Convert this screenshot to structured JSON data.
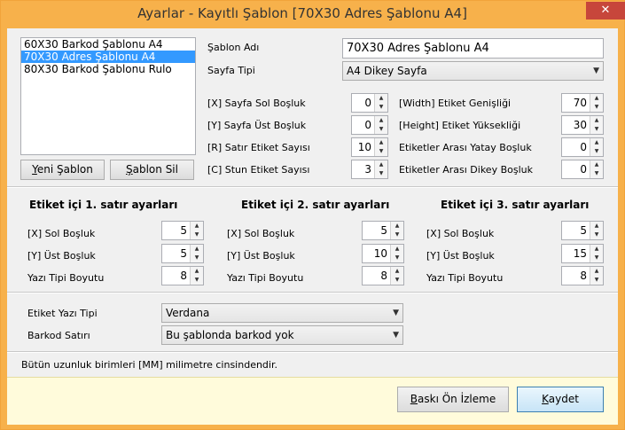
{
  "window": {
    "title": "Ayarlar - Kayıtlı Şablon [70X30 Adres Şablonu A4]",
    "close_glyph": "✕"
  },
  "templates": {
    "items": [
      "60X30 Barkod Şablonu A4",
      "70X30 Adres Şablonu A4",
      "80X30 Barkod Şablonu Rulo"
    ],
    "selected_index": 1,
    "new_button": {
      "mnemonic": "Y",
      "rest": "eni Şablon"
    },
    "delete_button": {
      "mnemonic": "Ş",
      "rest": "ablon Sil"
    }
  },
  "template_name": {
    "label": "Şablon Adı",
    "value": "70X30 Adres Şablonu A4"
  },
  "page_type": {
    "label": "Sayfa Tipi",
    "value": "A4 Dikey Sayfa"
  },
  "page_settings": [
    {
      "label": "[X] Sayfa Sol Boşluk",
      "value": "0"
    },
    {
      "label": "[Y] Sayfa Üst Boşluk",
      "value": "0"
    },
    {
      "label": "[R] Satır Etiket Sayısı",
      "value": "10"
    },
    {
      "label": "[C] Stun Etiket Sayısı",
      "value": "3"
    }
  ],
  "label_settings": [
    {
      "label": "[Width] Etiket Genişliği",
      "value": "70"
    },
    {
      "label": "[Height] Etiket Yüksekliği",
      "value": "30"
    },
    {
      "label": "Etiketler Arası Yatay Boşluk",
      "value": "0"
    },
    {
      "label": "Etiketler Arası Dikey Boşluk",
      "value": "0"
    }
  ],
  "line_settings": [
    {
      "header": "Etiket içi 1. satır ayarları",
      "rows": [
        {
          "label": "[X] Sol Boşluk",
          "value": "5"
        },
        {
          "label": "[Y] Üst Boşluk",
          "value": "5"
        },
        {
          "label": "Yazı Tipi Boyutu",
          "value": "8"
        }
      ]
    },
    {
      "header": "Etiket içi 2. satır ayarları",
      "rows": [
        {
          "label": "[X] Sol Boşluk",
          "value": "5"
        },
        {
          "label": "[Y] Üst Boşluk",
          "value": "10"
        },
        {
          "label": "Yazı Tipi Boyutu",
          "value": "8"
        }
      ]
    },
    {
      "header": "Etiket içi 3. satır ayarları",
      "rows": [
        {
          "label": "[X] Sol Boşluk",
          "value": "5"
        },
        {
          "label": "[Y] Üst Boşluk",
          "value": "15"
        },
        {
          "label": "Yazı Tipi Boyutu",
          "value": "8"
        }
      ]
    }
  ],
  "font": {
    "label": "Etiket Yazı Tipi",
    "value": "Verdana"
  },
  "barcode": {
    "label": "Barkod Satırı",
    "value": "Bu şablonda barkod yok"
  },
  "note": "Bütün uzunluk birimleri [MM] milimetre cinsindendir.",
  "preview_button": {
    "mnemonic": "B",
    "rest": "askı Ön İzleme"
  },
  "save_button": {
    "mnemonic": "K",
    "rest": "aydet"
  },
  "colors": {
    "titlebar": "#f7b14b",
    "selection": "#3399ff",
    "close": "#c7463b",
    "footer": "#fffbdb"
  }
}
